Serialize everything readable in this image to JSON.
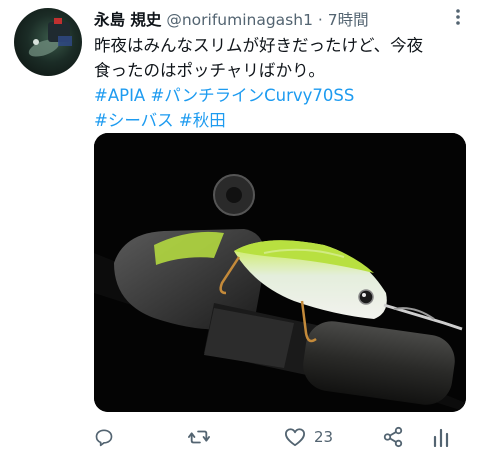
{
  "tweet": {
    "author_name": "永島 規史",
    "handle": "@norifuminagash1",
    "separator": "·",
    "time": "7時間",
    "text_line1": "昨夜はみんなスリムが好きだったけど、今夜",
    "text_line2": "食ったのはポッチャリばかり。",
    "hashtags_line1": [
      "#APIA",
      "#パンチラインCurvy70SS"
    ],
    "hashtags_line2": [
      "#シーバス",
      "#秋田"
    ]
  },
  "actions": {
    "reply": {
      "icon": "reply-icon"
    },
    "retweet": {
      "icon": "retweet-icon"
    },
    "like": {
      "icon": "heart-icon",
      "count": "23"
    },
    "share": {
      "icon": "share-icon"
    },
    "analytics": {
      "icon": "analytics-icon"
    }
  },
  "colors": {
    "link": "#1d9bf0",
    "secondary_text": "#536471",
    "lure_body": "#b8e040"
  }
}
